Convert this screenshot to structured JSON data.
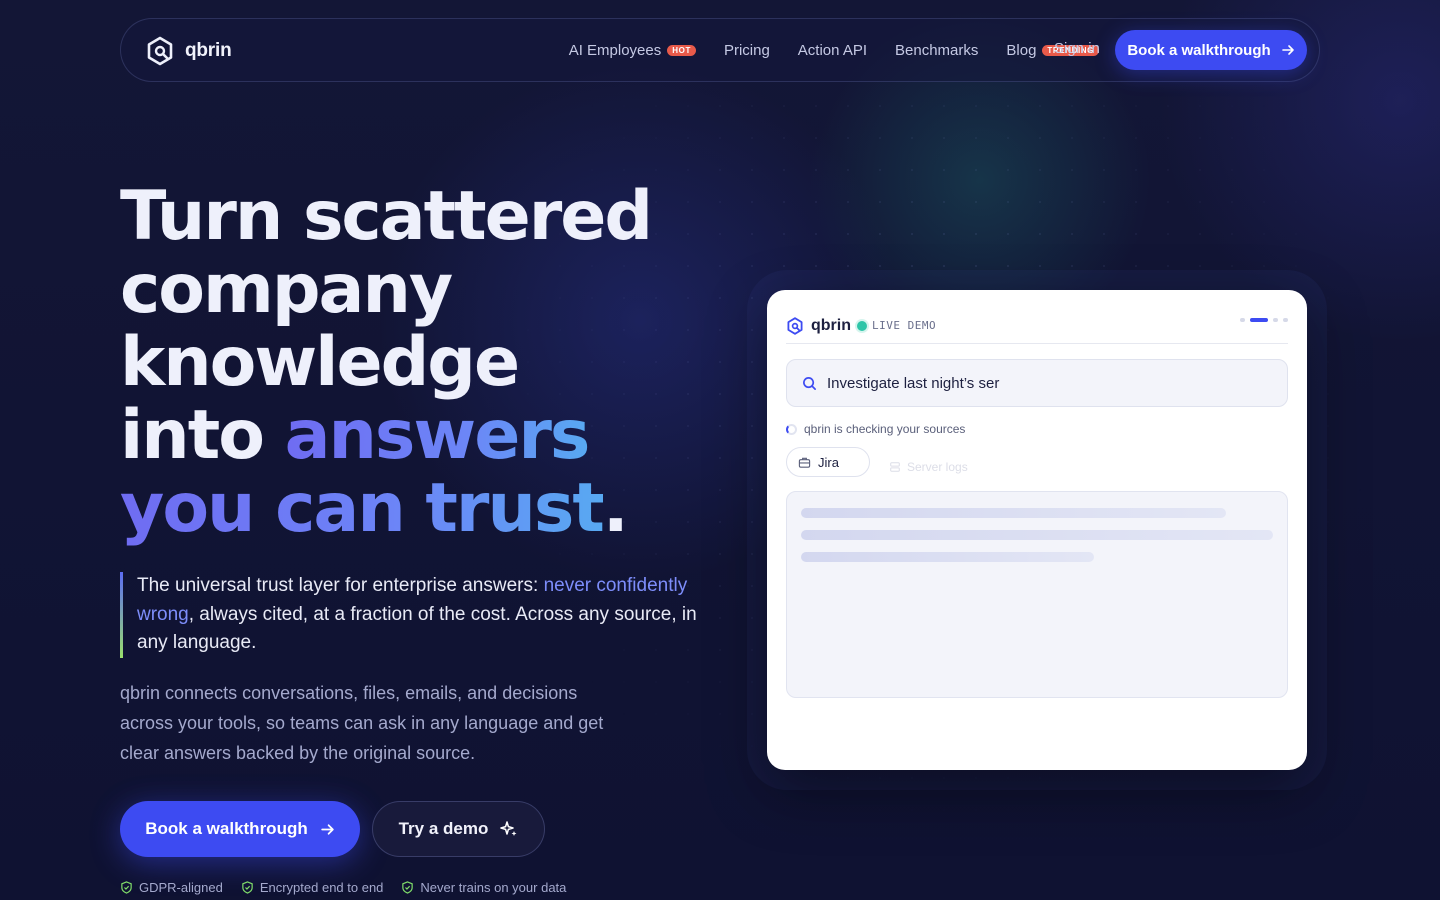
{
  "brand": {
    "name": "qbrin"
  },
  "nav": {
    "links": [
      {
        "label": "AI Employees",
        "badge": "HOT"
      },
      {
        "label": "Pricing"
      },
      {
        "label": "Action API"
      },
      {
        "label": "Benchmarks"
      },
      {
        "label": "Blog",
        "badge": "TRENDING"
      }
    ],
    "signin": "Sign in",
    "cta": "Book a walkthrough"
  },
  "hero": {
    "headline_line1": "Turn scattered",
    "headline_line2": "company",
    "headline_line3": "knowledge",
    "headline_into": "into ",
    "headline_answers": "answers",
    "headline_trust": "you can trust",
    "headline_period": ".",
    "quote_start": "The universal trust layer for enterprise answers: ",
    "quote_highlight": "never confidently wrong",
    "quote_end": ", always cited, at a fraction of the cost. Across any source, in any language.",
    "paragraph": "qbrin connects conversations, files, emails, and decisions across your tools, so teams can ask in any language and get clear answers backed by the original source.",
    "primary_cta": "Book a walkthrough",
    "secondary_cta": "Try a demo",
    "trust": [
      "GDPR-aligned",
      "Encrypted end to end",
      "Never trains on your data"
    ]
  },
  "demo": {
    "brand": "qbrin",
    "live_label": "LIVE DEMO",
    "query": "Investigate last night’s ser",
    "status": "qbrin is checking your sources",
    "source_chip": "Jira",
    "faded_chip": "Server logs"
  },
  "colors": {
    "accent": "#3d4bf2",
    "badge": "#e85a4a",
    "live": "#2ec5a8",
    "highlight": "#7d8dfa"
  }
}
